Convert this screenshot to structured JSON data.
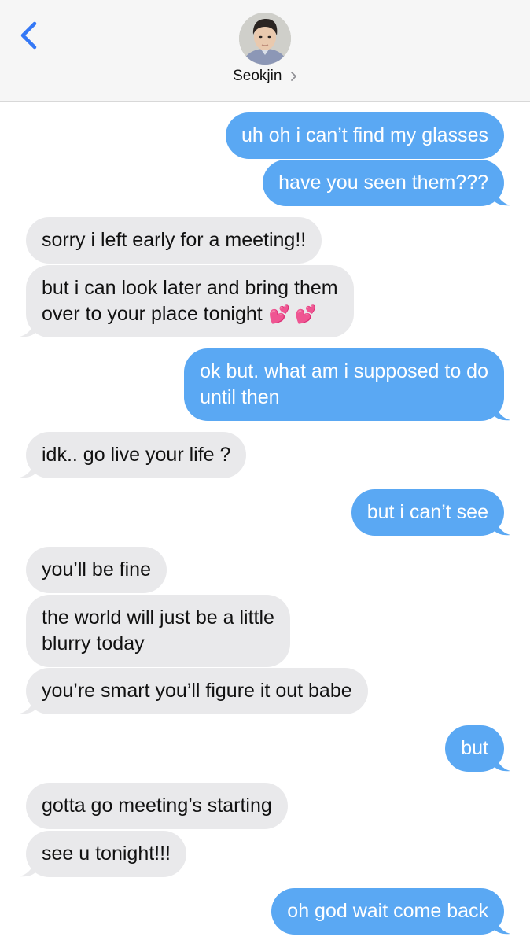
{
  "header": {
    "contact_name": "Seokjin",
    "back_icon": "chevron-left-icon",
    "detail_icon": "chevron-right-icon",
    "accent_color": "#3478f6"
  },
  "colors": {
    "outgoing_bubble": "#5aa8f3",
    "incoming_bubble": "#e9e9eb"
  },
  "messages": [
    {
      "direction": "outgoing",
      "lines": [
        "uh oh i can’t find my glasses"
      ]
    },
    {
      "direction": "outgoing",
      "lines": [
        "have you seen them???"
      ]
    },
    {
      "direction": "incoming",
      "lines": [
        "sorry i left early for a meeting!!"
      ]
    },
    {
      "direction": "incoming",
      "lines": [
        "but i can look later and bring them",
        "over to your place tonight"
      ],
      "emoji": "💕 💕"
    },
    {
      "direction": "outgoing",
      "lines": [
        "ok but. what am i supposed to do",
        "until then"
      ]
    },
    {
      "direction": "incoming",
      "lines": [
        "idk.. go live your life ?"
      ]
    },
    {
      "direction": "outgoing",
      "lines": [
        "but i can’t see"
      ]
    },
    {
      "direction": "incoming",
      "lines": [
        "you’ll be fine"
      ]
    },
    {
      "direction": "incoming",
      "lines": [
        "the world will just be a little",
        "blurry today"
      ]
    },
    {
      "direction": "incoming",
      "lines": [
        "you’re smart you’ll figure it out babe"
      ]
    },
    {
      "direction": "outgoing",
      "lines": [
        "but"
      ]
    },
    {
      "direction": "incoming",
      "lines": [
        "gotta go meeting’s starting"
      ]
    },
    {
      "direction": "incoming",
      "lines": [
        "see u tonight!!!"
      ]
    },
    {
      "direction": "outgoing",
      "lines": [
        "oh god wait come back"
      ]
    }
  ]
}
